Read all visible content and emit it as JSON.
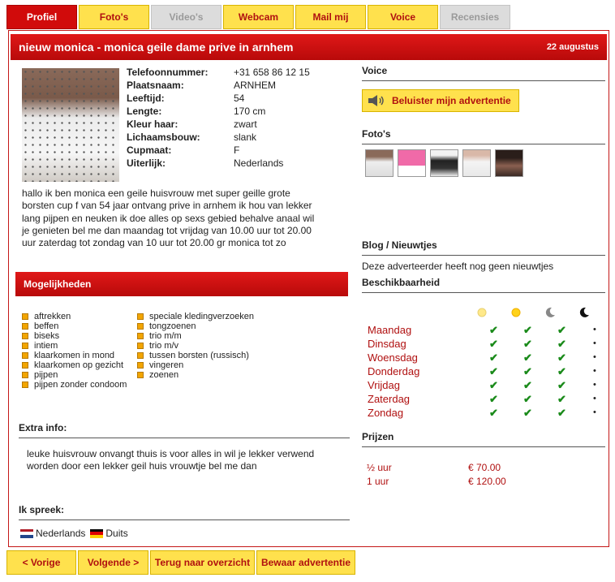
{
  "tabs": [
    {
      "label": "Profiel",
      "state": "active"
    },
    {
      "label": "Foto's",
      "state": "normal"
    },
    {
      "label": "Video's",
      "state": "disabled"
    },
    {
      "label": "Webcam",
      "state": "normal"
    },
    {
      "label": "Mail mij",
      "state": "normal"
    },
    {
      "label": "Voice",
      "state": "normal"
    },
    {
      "label": "Recensies",
      "state": "disabled"
    }
  ],
  "header": {
    "title": "nieuw monica - monica geile dame prive in arnhem",
    "date": "22 augustus"
  },
  "profile": {
    "fields": [
      {
        "key": "Telefoonnummer:",
        "value": "+31 658 86 12 15"
      },
      {
        "key": "Plaatsnaam:",
        "value": "ARNHEM"
      },
      {
        "key": "Leeftijd:",
        "value": "54"
      },
      {
        "key": "Lengte:",
        "value": "170 cm"
      },
      {
        "key": "Kleur haar:",
        "value": "zwart"
      },
      {
        "key": "Lichaamsbouw:",
        "value": "slank"
      },
      {
        "key": "Cupmaat:",
        "value": "F"
      },
      {
        "key": "Uiterlijk:",
        "value": "Nederlands"
      }
    ],
    "description": "hallo ik ben monica een geile huisvrouw met super geille grote borsten cup f van 54 jaar ontvang prive in arnhem ik hou van lekker lang pijpen en neuken ik doe alles op sexs gebied behalve anaal wil je genieten bel me dan maandag tot vrijdag van 10.00 uur tot 20.00 uur zaterdag tot zondag van 10 uur tot 20.00 gr monica tot zo"
  },
  "options": {
    "title": "Mogelijkheden",
    "col1": [
      "aftrekken",
      "beffen",
      "biseks",
      "intiem",
      "klaarkomen in mond",
      "klaarkomen op gezicht",
      "pijpen",
      "pijpen zonder condoom"
    ],
    "col2": [
      "speciale kledingverzoeken",
      "tongzoenen",
      "trio m/m",
      "trio m/v",
      "tussen borsten (russisch)",
      "vingeren",
      "zoenen"
    ]
  },
  "extra": {
    "title": "Extra info:",
    "text": "leuke huisvrouw onvangt thuis is voor alles in wil je lekker verwend worden door een lekker geil huis vrouwtje bel me dan"
  },
  "languages": {
    "title": "Ik spreek:",
    "items": [
      "Nederlands",
      "Duits"
    ]
  },
  "voice": {
    "title": "Voice",
    "button": "Beluister mijn advertentie",
    "icon": "speaker-icon"
  },
  "photos": {
    "title": "Foto's",
    "count": 5
  },
  "blog": {
    "title": "Blog / Nieuwtjes",
    "message": "Deze adverteerder heeft nog geen nieuwtjes"
  },
  "availability": {
    "title": "Beschikbaarheid",
    "periods": [
      "morning-sun-icon",
      "afternoon-sun-icon",
      "evening-moon-icon",
      "night-moon-icon"
    ],
    "days": [
      {
        "name": "Maandag",
        "slots": [
          true,
          true,
          true,
          false
        ]
      },
      {
        "name": "Dinsdag",
        "slots": [
          true,
          true,
          true,
          false
        ]
      },
      {
        "name": "Woensdag",
        "slots": [
          true,
          true,
          true,
          false
        ]
      },
      {
        "name": "Donderdag",
        "slots": [
          true,
          true,
          true,
          false
        ]
      },
      {
        "name": "Vrijdag",
        "slots": [
          true,
          true,
          true,
          false
        ]
      },
      {
        "name": "Zaterdag",
        "slots": [
          true,
          true,
          true,
          false
        ]
      },
      {
        "name": "Zondag",
        "slots": [
          true,
          true,
          true,
          false
        ]
      }
    ],
    "check_symbol": "✔",
    "none_symbol": "•"
  },
  "prices": {
    "title": "Prijzen",
    "items": [
      {
        "duration": "½  uur",
        "price": "€ 70.00"
      },
      {
        "duration": "1   uur",
        "price": "€ 120.00"
      }
    ]
  },
  "bottom": {
    "prev": "< Vorige",
    "next": "Volgende >",
    "back": "Terug naar overzicht",
    "save": "Bewaar advertentie"
  },
  "colors": {
    "accent_red": "#c41818",
    "tab_yellow": "#ffe14d",
    "check_green": "#1a8a1a"
  }
}
